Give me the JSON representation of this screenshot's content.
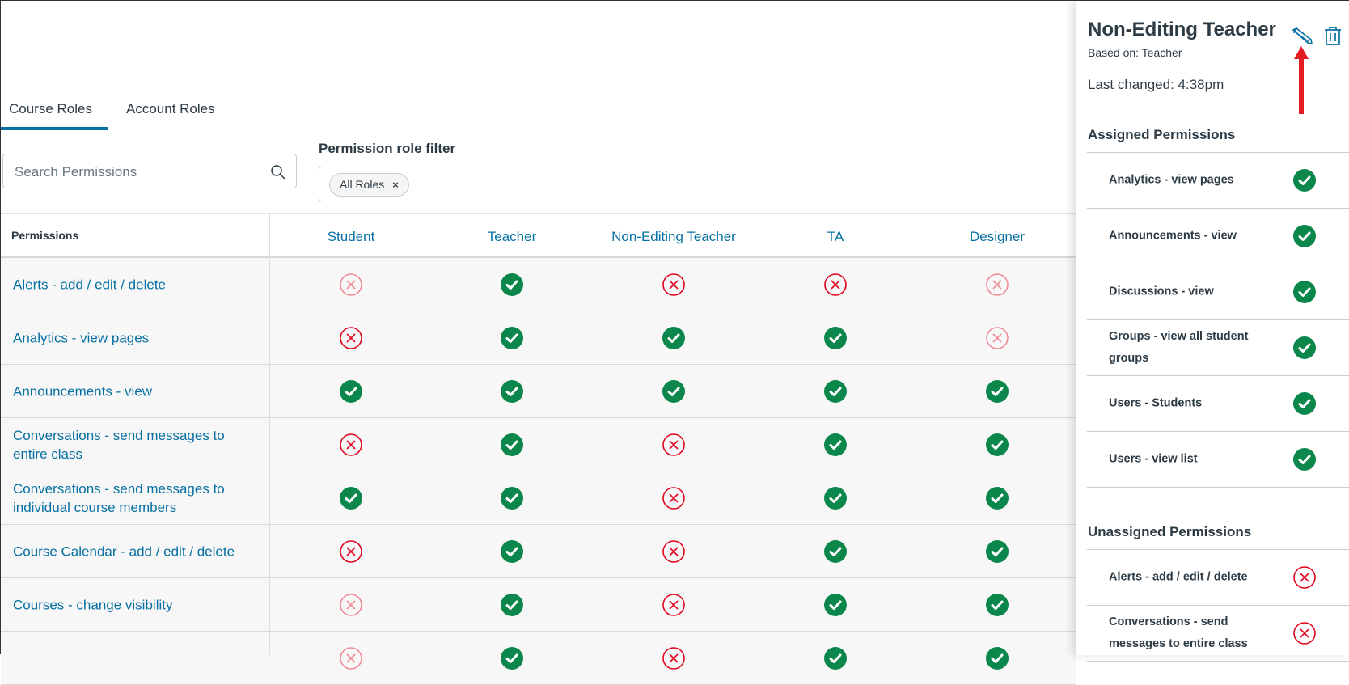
{
  "tabs": [
    {
      "label": "Course Roles",
      "active": true
    },
    {
      "label": "Account Roles",
      "active": false
    }
  ],
  "search": {
    "placeholder": "Search Permissions",
    "icon": "search-icon"
  },
  "filter": {
    "label": "Permission role filter",
    "chip": "All Roles",
    "chip_remove": "×"
  },
  "table": {
    "permissions_header": "Permissions",
    "roles": [
      "Student",
      "Teacher",
      "Non-Editing Teacher",
      "TA",
      "Designer"
    ],
    "rows": [
      {
        "name": "Alerts - add / edit / delete",
        "states": [
          "off-inherited",
          "on",
          "off",
          "off",
          "off-inherited"
        ]
      },
      {
        "name": "Analytics - view pages",
        "states": [
          "off",
          "on",
          "on",
          "on",
          "off-inherited"
        ]
      },
      {
        "name": "Announcements - view",
        "states": [
          "on",
          "on",
          "on",
          "on",
          "on"
        ]
      },
      {
        "name": "Conversations - send messages to entire class",
        "states": [
          "off",
          "on",
          "off",
          "on",
          "on"
        ]
      },
      {
        "name": "Conversations - send messages to individual course members",
        "states": [
          "on",
          "on",
          "off",
          "on",
          "on"
        ]
      },
      {
        "name": "Course Calendar - add / edit / delete",
        "states": [
          "off",
          "on",
          "off",
          "on",
          "on"
        ]
      },
      {
        "name": "Courses - change visibility",
        "states": [
          "off-inherited",
          "on",
          "off",
          "on",
          "on"
        ]
      },
      {
        "name": "",
        "states": [
          "off-inherited",
          "on",
          "off",
          "on",
          "on"
        ]
      }
    ]
  },
  "panel": {
    "title": "Non-Editing Teacher",
    "based_on": "Based on: Teacher",
    "last_changed": "Last changed: 4:38pm",
    "assigned_header": "Assigned Permissions",
    "assigned": [
      "Analytics - view pages",
      "Announcements - view",
      "Discussions - view",
      "Groups - view all student groups",
      "Users - Students",
      "Users - view list"
    ],
    "unassigned_header": "Unassigned Permissions",
    "unassigned": [
      "Alerts - add / edit / delete",
      "Conversations - send messages to entire class"
    ]
  },
  "colors": {
    "accent": "#0770a3",
    "enabled": "#0b874b",
    "disabled": "#e0061f",
    "disabled_light": "#f08b97",
    "annotation": "#e31b23"
  }
}
